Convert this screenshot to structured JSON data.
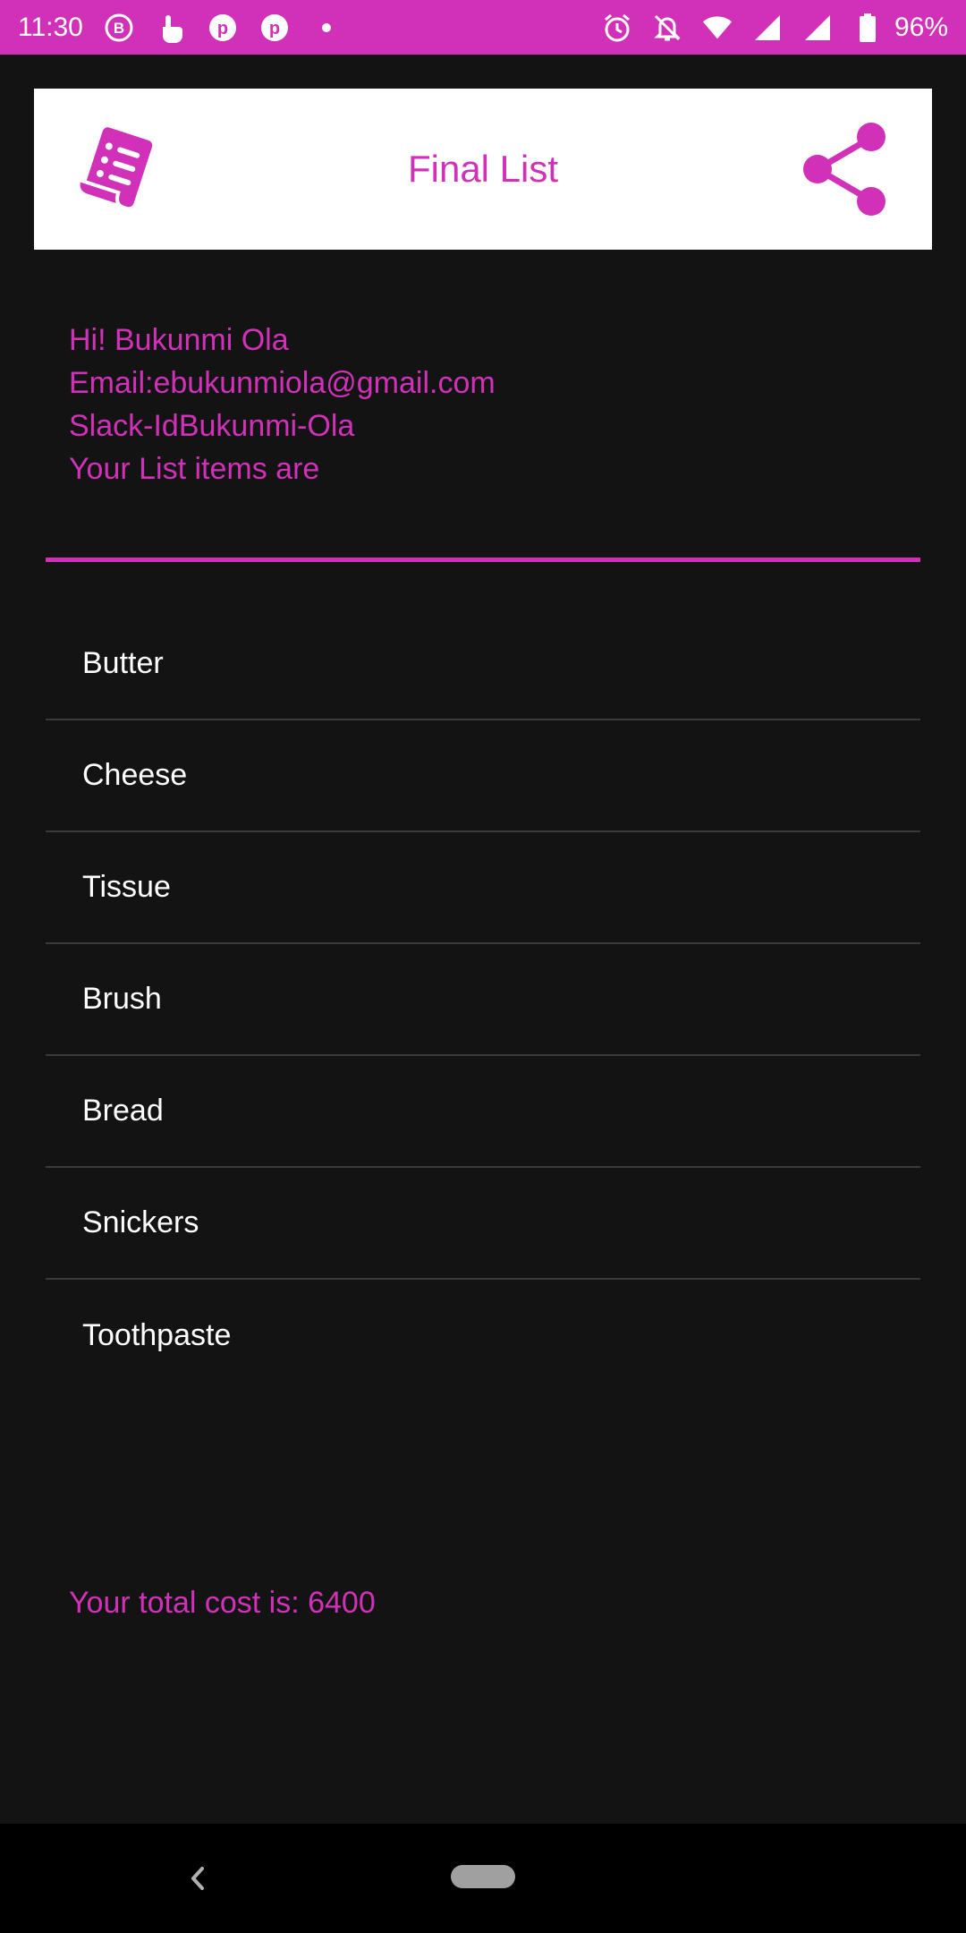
{
  "status_bar": {
    "time": "11:30",
    "battery": "96%",
    "left_icons": [
      "b-circle-icon",
      "touch-hand-icon",
      "pinterest-icon",
      "pinterest-icon",
      "dot-icon"
    ],
    "right_icons": [
      "alarm-icon",
      "notifications-off-icon",
      "wifi-icon",
      "signal-icon",
      "signal-icon",
      "battery-icon"
    ]
  },
  "app_bar": {
    "title": "Final List",
    "logo_icon": "receipt-list-icon",
    "share_icon": "share-icon"
  },
  "info": {
    "greeting": "Hi! Bukunmi Ola",
    "email": "Email:ebukunmiola@gmail.com",
    "slack": "Slack-IdBukunmi-Ola",
    "list_intro": "Your List items are"
  },
  "list": {
    "items": [
      "Butter",
      "Cheese",
      "Tissue",
      "Brush",
      "Bread",
      "Snickers",
      "Toothpaste"
    ]
  },
  "total": {
    "text": "Your total cost is: 6400"
  },
  "colors": {
    "accent": "#d131b8",
    "background": "#131313",
    "text": "#ffffff",
    "app_bar": "#ffffff"
  }
}
